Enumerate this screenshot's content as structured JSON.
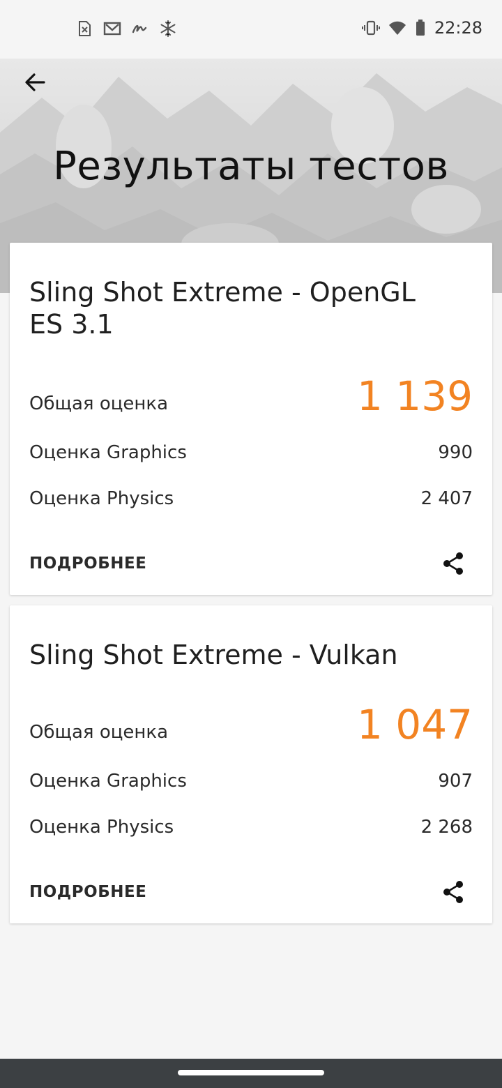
{
  "status_bar": {
    "time": "22:28",
    "left_icons": [
      "sim-error-icon",
      "gmail-icon",
      "signature-icon",
      "snowflake-icon"
    ],
    "right_icons": [
      "vibrate-icon",
      "wifi-icon",
      "battery-icon"
    ]
  },
  "header": {
    "title": "Результаты тестов",
    "back_icon": "arrow-left-icon"
  },
  "colors": {
    "accent": "#f28322",
    "nav_bar": "#3c4043"
  },
  "results": [
    {
      "title": "Sling Shot Extreme - OpenGL ES 3.1",
      "total_label": "Общая оценка",
      "total_value": "1 139",
      "graphics_label": "Оценка Graphics",
      "graphics_value": "990",
      "physics_label": "Оценка Physics",
      "physics_value": "2 407",
      "details_label": "ПОДРОБНЕЕ",
      "share_icon": "share-icon"
    },
    {
      "title": "Sling Shot Extreme - Vulkan",
      "total_label": "Общая оценка",
      "total_value": "1 047",
      "graphics_label": "Оценка Graphics",
      "graphics_value": "907",
      "physics_label": "Оценка Physics",
      "physics_value": "2 268",
      "details_label": "ПОДРОБНЕЕ",
      "share_icon": "share-icon"
    }
  ]
}
